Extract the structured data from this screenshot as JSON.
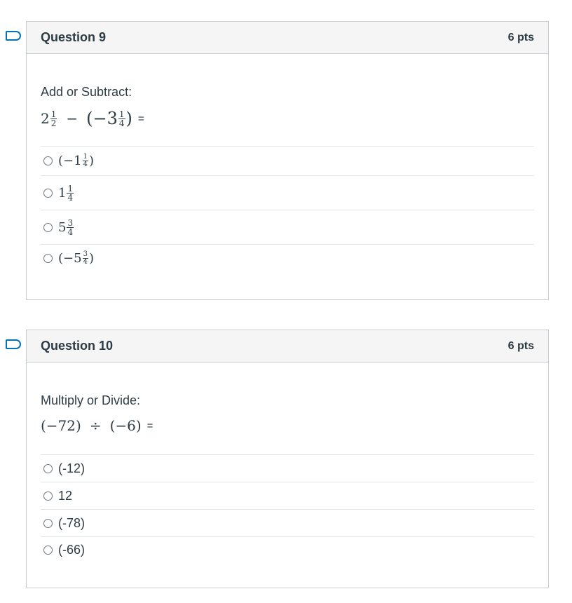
{
  "questions": [
    {
      "title": "Question 9",
      "points": "6 pts",
      "prompt": "Add or Subtract:",
      "expression": {
        "a_whole": "2",
        "a_num": "1",
        "a_den": "2",
        "operator": "−",
        "b_open": "(−3",
        "b_num": "1",
        "b_den": "4",
        "b_close": ")",
        "equals": "="
      },
      "answers": [
        {
          "open": "(−1",
          "num": "1",
          "den": "4",
          "close": ")"
        },
        {
          "whole": "1",
          "num": "1",
          "den": "4"
        },
        {
          "whole": "5",
          "num": "3",
          "den": "4"
        },
        {
          "open": "(−5",
          "num": "3",
          "den": "4",
          "close": ")"
        }
      ]
    },
    {
      "title": "Question 10",
      "points": "6 pts",
      "prompt": "Multiply or Divide:",
      "expression": {
        "left": "(−72)",
        "operator": "÷",
        "right": "(−6)",
        "equals": "="
      },
      "answers": [
        {
          "label": "(-12)"
        },
        {
          "label": "12"
        },
        {
          "label": "(-78)"
        },
        {
          "label": "(-66)"
        }
      ]
    }
  ]
}
